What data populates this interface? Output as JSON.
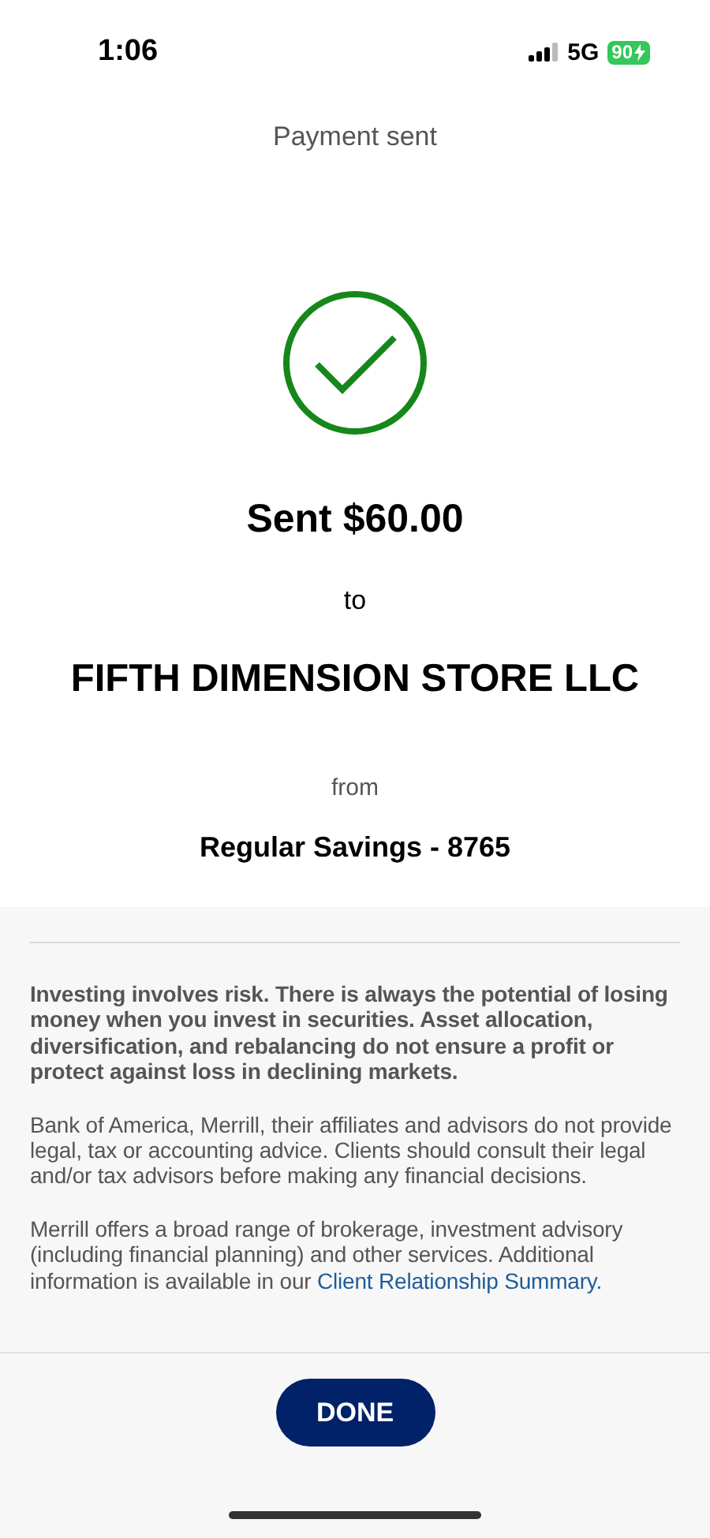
{
  "status_bar": {
    "time": "1:06",
    "network": "5G",
    "battery": "90",
    "charging": true
  },
  "header": {
    "title": "Payment sent"
  },
  "confirmation": {
    "amount": "Sent $60.00",
    "to_label": "to",
    "recipient": "FIFTH DIMENSION STORE LLC",
    "from_label": "from",
    "account": "Regular Savings - 8765"
  },
  "disclosures": [
    {
      "kind": "bold",
      "text": "Investing involves risk. There is always the potential of losing money when you invest in securities. Asset allocation, diversification, and rebalancing do not ensure a profit or protect against loss in declining markets."
    },
    {
      "kind": "plain",
      "text": "Bank of America, Merrill, their affiliates and advisors do not provide legal, tax or accounting advice. Clients should consult their legal and/or tax advisors before making any financial decisions."
    },
    {
      "kind": "link",
      "text": "Merrill offers a broad range of brokerage, investment advisory (including financial planning) and other services. Additional information is available in our ",
      "link": "Client Relationship Summary."
    }
  ],
  "footer": {
    "button": "DONE"
  }
}
